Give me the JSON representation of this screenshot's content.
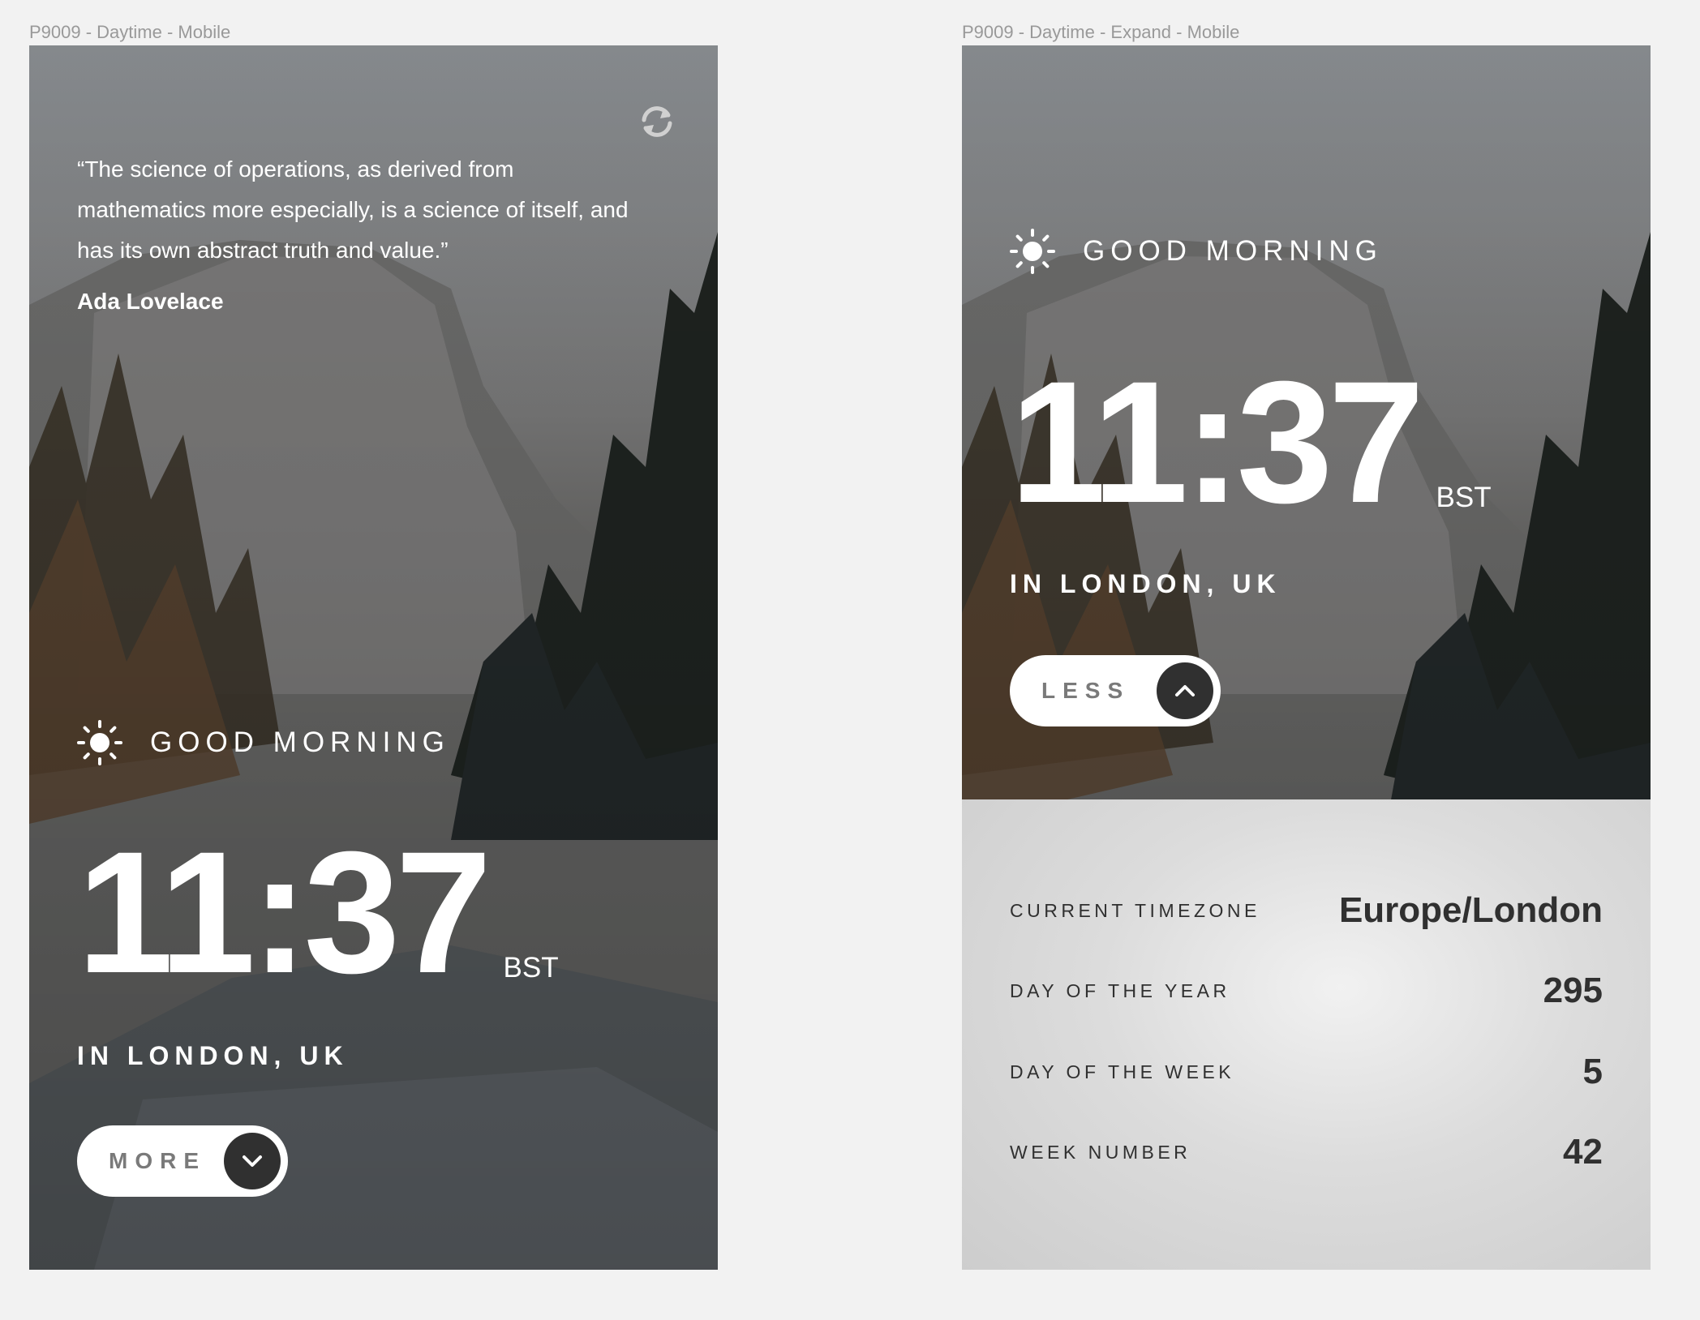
{
  "frames": [
    {
      "label": "P9009 - Daytime - Mobile",
      "quote": "“The science of operations, as derived from mathematics more especially, is a science of itself, and has its own abstract truth and value.”",
      "author": "Ada Lovelace",
      "refresh_icon": "refresh-icon",
      "greeting_icon": "sun-icon",
      "greeting": "GOOD MORNING",
      "time": "11:37",
      "timezone_abbr": "BST",
      "location": "IN LONDON, UK",
      "toggle": {
        "label": "MORE",
        "icon": "chevron-down-icon"
      }
    },
    {
      "label": "P9009 - Daytime - Expand - Mobile",
      "greeting_icon": "sun-icon",
      "greeting": "GOOD MORNING",
      "time": "11:37",
      "timezone_abbr": "BST",
      "location": "IN LONDON, UK",
      "toggle": {
        "label": "LESS",
        "icon": "chevron-up-icon"
      },
      "details": [
        {
          "label": "CURRENT TIMEZONE",
          "value": "Europe/London"
        },
        {
          "label": "DAY OF THE YEAR",
          "value": "295"
        },
        {
          "label": "DAY OF THE WEEK",
          "value": "5"
        },
        {
          "label": "WEEK NUMBER",
          "value": "42"
        }
      ]
    }
  ],
  "colors": {
    "canvas": "#f2f2f2",
    "text_light": "#ffffff",
    "text_dark": "#303030",
    "button_circle": "#303030",
    "button_label": "#7a7a7a",
    "panel": "#dcdcdc"
  }
}
